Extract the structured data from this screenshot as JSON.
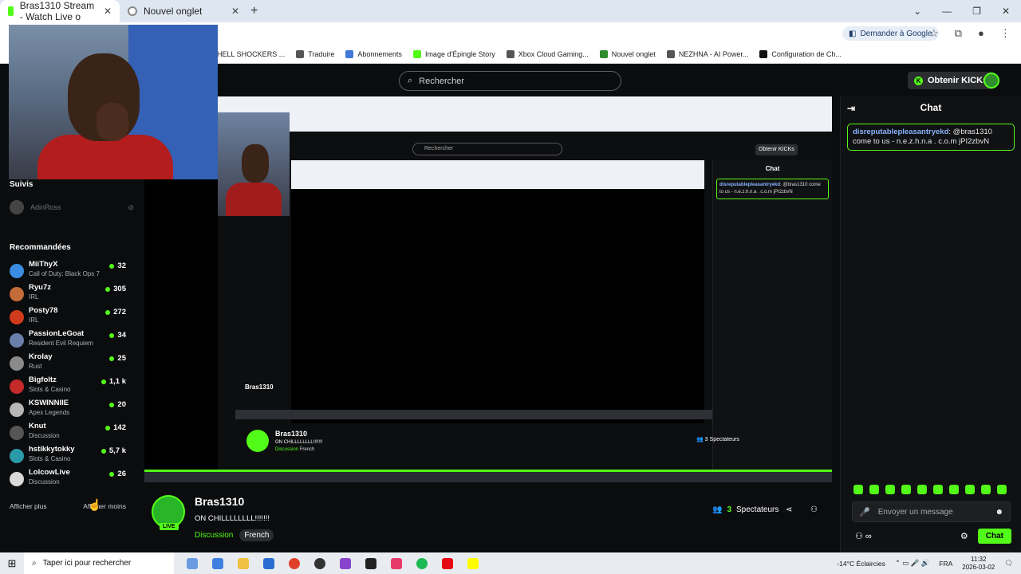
{
  "browser": {
    "tabs": [
      {
        "label": "Bras1310 Stream - Watch Live o",
        "active": true
      },
      {
        "label": "Nouvel onglet",
        "active": false
      }
    ],
    "ask_google": "Demander à Google",
    "bookmarks": [
      "HELL SHOCKERS ...",
      "Traduire",
      "Abonnements",
      "Image d'Épingle Story",
      "Xbox Cloud Gaming...",
      "Nouvel onglet",
      "NEZHNA - AI Power...",
      "Configuration de Ch..."
    ]
  },
  "header": {
    "search_placeholder": "Rechercher",
    "kicks_label": "Obtenir KICKs"
  },
  "sidebar": {
    "followed_title": "Suivis",
    "followed_user": "AdinRoss",
    "recommended_title": "Recommandées",
    "channels": [
      {
        "name": "MiiThyX",
        "category": "Call of Duty: Black Ops 7",
        "viewers": "32",
        "color": "#3a8de0"
      },
      {
        "name": "Ryu7z",
        "category": "IRL",
        "viewers": "305",
        "color": "#c46b3a"
      },
      {
        "name": "Posty78",
        "category": "IRL",
        "viewers": "272",
        "color": "#d13a1a"
      },
      {
        "name": "PassionLeGoat",
        "category": "Resident Evil Requiem",
        "viewers": "34",
        "color": "#6a7faa"
      },
      {
        "name": "Krolay",
        "category": "Rust",
        "viewers": "25",
        "color": "#8a8a8a"
      },
      {
        "name": "Bigfoltz",
        "category": "Slots & Casino",
        "viewers": "1,1 k",
        "color": "#c42a2a"
      },
      {
        "name": "KSWINNIIE",
        "category": "Apex Legends",
        "viewers": "20",
        "color": "#b7b7b7"
      },
      {
        "name": "Knut",
        "category": "Discussion",
        "viewers": "142",
        "color": "#555555"
      },
      {
        "name": "hstikkytokky",
        "category": "Slots & Casino",
        "viewers": "5,7 k",
        "color": "#2b9aa8"
      },
      {
        "name": "LolcowLive",
        "category": "Discussion",
        "viewers": "26",
        "color": "#d9d9d9"
      }
    ],
    "show_more": "Afficher plus",
    "show_less": "Afficher moins"
  },
  "stream": {
    "channel": "Bras1310",
    "title": "ON CHILLLLLLLL!!!!!!!",
    "category": "Discussion",
    "language": "French",
    "live_badge": "LIVE",
    "spectators_count": "3",
    "spectators_label": "Spectateurs"
  },
  "chat": {
    "title": "Chat",
    "messages": [
      {
        "user": "disreputablepleasantryekd",
        "text": ": @bras1310 come to us - n.e.z.h.n.a . c.o.m jPI2zbvN"
      }
    ],
    "input_placeholder": "Envoyer un message",
    "send_label": "Chat"
  },
  "taskbar": {
    "search_placeholder": "Taper ici pour rechercher",
    "weather": "-14°C  Éclaircies",
    "lang": "FRA",
    "time": "11:32",
    "date": "2026-03-02"
  },
  "colors": {
    "accent": "#53fc18",
    "background": "#0b0c0e",
    "chat_user": "#8ab4ff"
  }
}
